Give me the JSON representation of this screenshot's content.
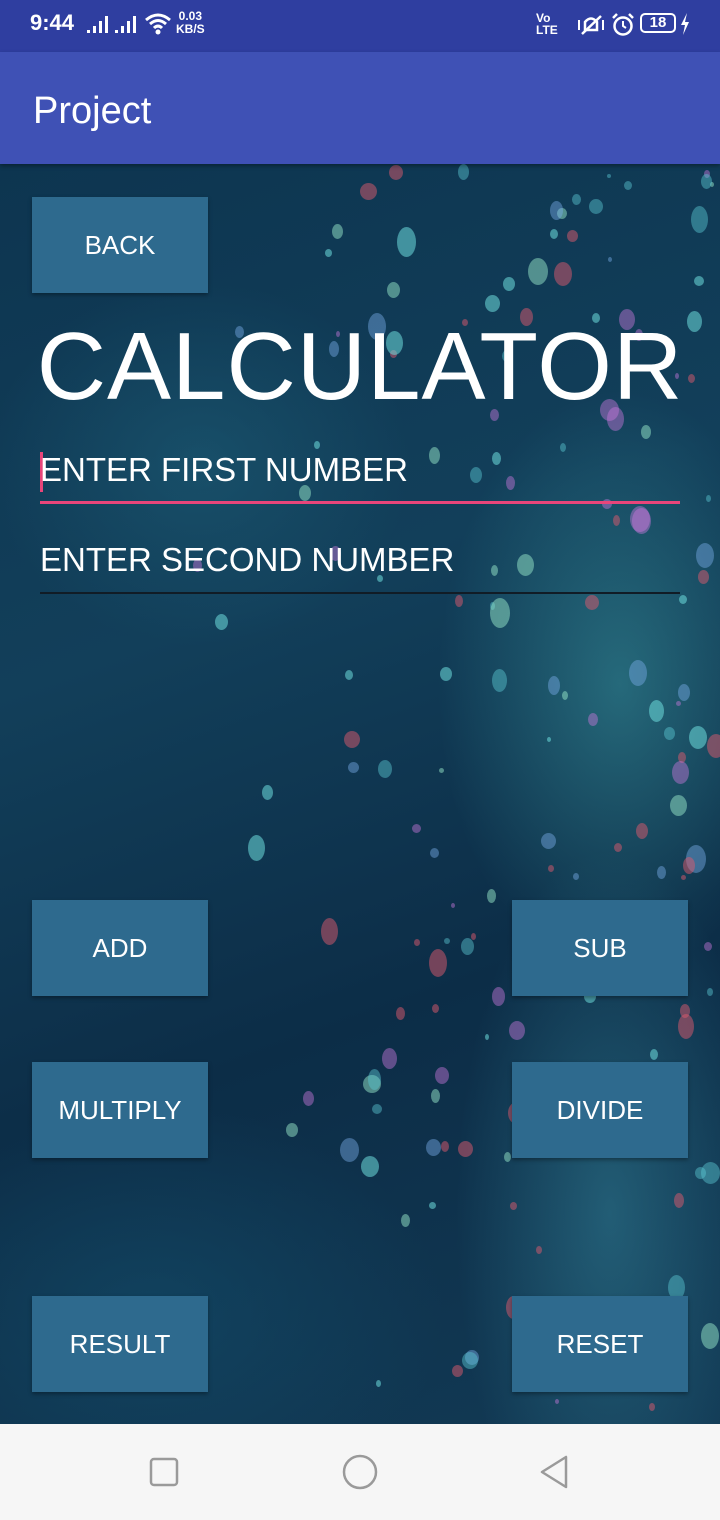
{
  "status_bar": {
    "time": "9:44",
    "net_speed_value": "0.03",
    "net_speed_unit": "KB/S",
    "volte_line1": "Vo",
    "volte_line2": "LTE",
    "battery": "18"
  },
  "app_bar": {
    "title": "Project"
  },
  "screen": {
    "back_label": "BACK",
    "title": "CALCULATOR",
    "first_field": {
      "placeholder": "ENTER FIRST NUMBER",
      "value": ""
    },
    "second_field": {
      "placeholder": "ENTER SECOND NUMBER",
      "value": ""
    },
    "buttons": {
      "add": "ADD",
      "sub": "SUB",
      "multiply": "MULTIPLY",
      "divide": "DIVIDE",
      "result": "RESULT",
      "reset": "RESET"
    }
  },
  "colors": {
    "status_bar": "#2f3ea0",
    "app_bar": "#3f51b5",
    "button": "#2e6a8e",
    "focus_accent": "#e9457a"
  },
  "icons": [
    "signal-icon",
    "wifi-icon",
    "vibrate-icon",
    "alarm-icon",
    "battery-icon",
    "charging-icon",
    "recents-icon",
    "home-icon",
    "back-nav-icon"
  ]
}
